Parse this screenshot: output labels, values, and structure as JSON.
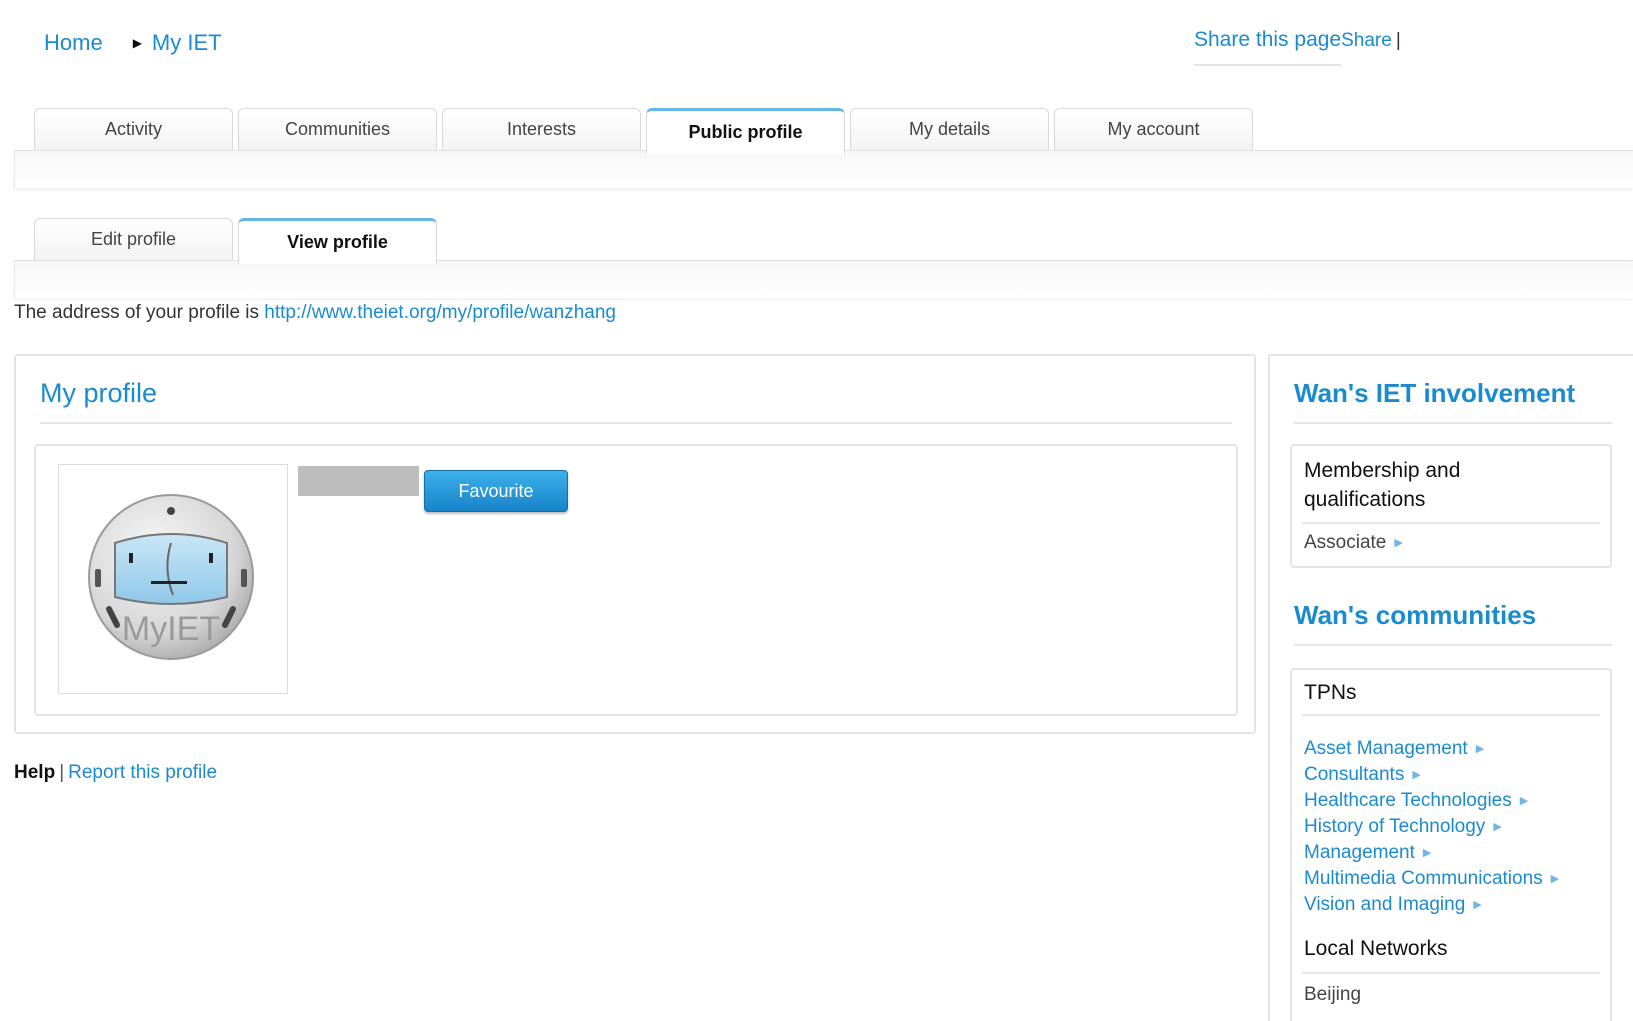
{
  "breadcrumb": {
    "home": "Home",
    "current": "My IET"
  },
  "share": {
    "page_label": "Share this page",
    "share_label": "Share",
    "pipe": "|"
  },
  "main_tabs": [
    {
      "label": "Activity"
    },
    {
      "label": "Communities"
    },
    {
      "label": "Interests"
    },
    {
      "label": "Public profile",
      "active": true
    },
    {
      "label": "My details"
    },
    {
      "label": "My account"
    }
  ],
  "sub_tabs": [
    {
      "label": "Edit profile"
    },
    {
      "label": "View profile",
      "active": true
    }
  ],
  "address": {
    "prefix": "The address of your profile is",
    "url": "http://www.theiet.org/my/profile/wanzhang"
  },
  "profile": {
    "title": "My profile",
    "avatar_text": "MyIET",
    "favourite_label": "Favourite"
  },
  "footer": {
    "help": "Help",
    "pipe": "|",
    "report": "Report this profile"
  },
  "sidebar": {
    "involvement_title": "Wan's IET involvement",
    "membership_heading": "Membership and qualifications",
    "membership_value": "Associate",
    "communities_title": "Wan's communities",
    "tpns_heading": "TPNs",
    "tpns": [
      "Asset Management",
      "Consultants",
      "Healthcare Technologies",
      "History of Technology",
      "Management",
      "Multimedia Communications",
      "Vision and Imaging"
    ],
    "local_heading": "Local Networks",
    "local_value": "Beijing"
  },
  "colors": {
    "link": "#1a8bd0",
    "button": "#1784c9",
    "active_tab_top": "#63b8e6"
  }
}
